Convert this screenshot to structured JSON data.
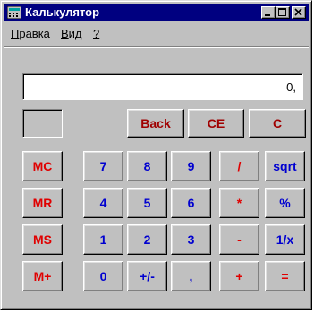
{
  "window": {
    "title": "Калькулятор",
    "controls": [
      "minimize-icon",
      "maximize-icon",
      "close-icon"
    ]
  },
  "menu": {
    "items": [
      {
        "label": "Правка",
        "underline": "П",
        "rest": "равка"
      },
      {
        "label": "Вид",
        "underline": "В",
        "rest": "ид"
      },
      {
        "label": "?",
        "underline": "?",
        "rest": ""
      }
    ]
  },
  "display": {
    "value": "0,"
  },
  "colors": {
    "title_bg": "#000080",
    "face": "#c0c0c0",
    "digit": "#0000d0",
    "operator": "#e00000",
    "edit": "#a00000"
  },
  "buttons": {
    "back": "Back",
    "ce": "CE",
    "c": "C",
    "mc": "MC",
    "mr": "MR",
    "ms": "MS",
    "mplus": "M+",
    "d7": "7",
    "d8": "8",
    "d9": "9",
    "div": "/",
    "sqrt": "sqrt",
    "d4": "4",
    "d5": "5",
    "d6": "6",
    "mul": "*",
    "pct": "%",
    "d1": "1",
    "d2": "2",
    "d3": "3",
    "sub": "-",
    "inv": "1/x",
    "d0": "0",
    "sign": "+/-",
    "dec": ",",
    "add": "+",
    "eq": "="
  }
}
